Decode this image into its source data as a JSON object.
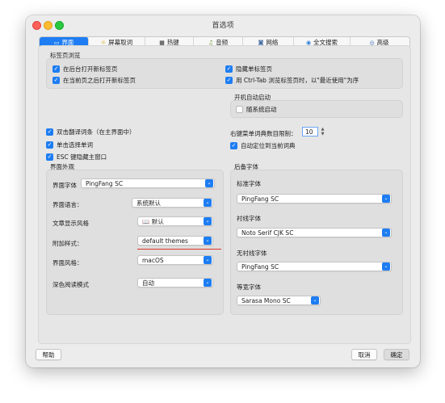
{
  "window": {
    "title": "首选项"
  },
  "tabs": [
    {
      "icon": "monitor-icon",
      "label": "界面"
    },
    {
      "icon": "lightbulb-icon",
      "label": "屏幕取词"
    },
    {
      "icon": "keyboard-icon",
      "label": "热键"
    },
    {
      "icon": "music-note-icon",
      "label": "音频"
    },
    {
      "icon": "network-icon",
      "label": "网络"
    },
    {
      "icon": "globe-icon",
      "label": "全文搜索"
    },
    {
      "icon": "advanced-icon",
      "label": "高级"
    }
  ],
  "tab_glyphs": [
    "▭",
    "☼",
    "▦",
    "♫",
    "◙",
    "◉",
    "◎"
  ],
  "browsing": {
    "title": "标签页浏览",
    "open_in_background": {
      "label": "在后台打开新标签页",
      "checked": true
    },
    "open_after_current": {
      "label": "在当前页之后打开新标签页",
      "checked": true
    },
    "hide_single_tab": {
      "label": "隐藏单标签页",
      "checked": true
    },
    "ctrl_tab_mru": {
      "label": "用 Ctrl-Tab 浏览标签页时，以\"最近使用\"为序",
      "checked": true
    }
  },
  "autostart": {
    "title": "开机自动启动",
    "start_with_system": {
      "label": "随系统启动",
      "checked": false
    }
  },
  "misc": {
    "dbl_click_translate": {
      "label": "双击翻译词条（在主界面中）",
      "checked": true
    },
    "single_click_select": {
      "label": "单击选择单词",
      "checked": true
    },
    "esc_hide": {
      "label": "ESC 键隐藏主窗口",
      "checked": true
    },
    "context_menu_limit_label": "右键菜单词典数目限制：",
    "context_menu_limit_value": "10",
    "auto_locate": {
      "label": "自动定位到当前词典",
      "checked": true
    }
  },
  "appearance": {
    "title": "界面外观",
    "font_label": "界面字体",
    "font_value": "PingFang SC",
    "language_label": "界面语言：",
    "language_value": "系统默认",
    "article_style_label": "文章显示风格",
    "article_style_value": "默认",
    "article_style_icon": "book-icon",
    "addon_style_label": "附加样式：",
    "addon_style_value": "default themes",
    "ui_style_label": "界面风格：",
    "ui_style_value": "macOS",
    "dark_mode_label": "深色阅读模式",
    "dark_mode_value": "自动"
  },
  "fallback_fonts": {
    "title": "后备字体",
    "standard_label": "标准字体",
    "standard_value": "PingFang SC",
    "serif_label": "衬线字体",
    "serif_value": "Noto Serif CJK SC",
    "sans_label": "无衬线字体",
    "sans_value": "PingFang SC",
    "mono_label": "等宽字体",
    "mono_value": "Sarasa Mono SC"
  },
  "buttons": {
    "help": "帮助",
    "cancel": "取消",
    "ok": "确定"
  },
  "glyphs": {
    "check": "✓",
    "dropdown": "⌄",
    "stepper_up": "▲",
    "stepper_down": "▼",
    "book": "📖"
  },
  "colors": {
    "accent": "#1e7df2",
    "underline": "#d9352b"
  }
}
